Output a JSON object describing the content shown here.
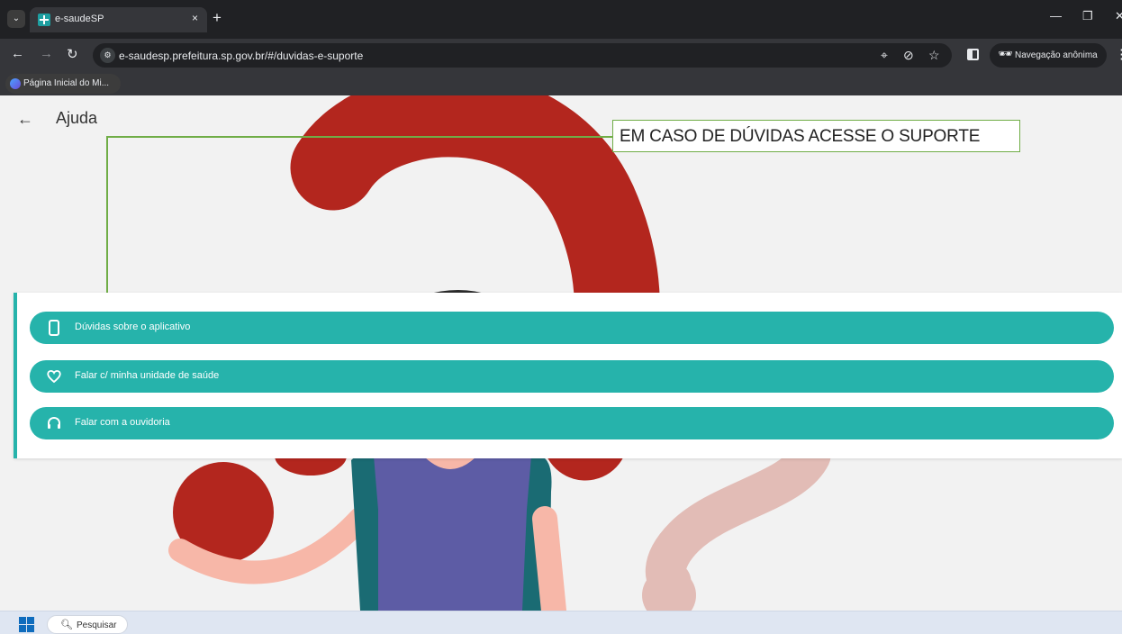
{
  "browser": {
    "tab_title": "e-saudeSP",
    "tab_close": "×",
    "new_tab": "+",
    "url": "e-saudesp.prefeitura.sp.gov.br/#/duvidas-e-suporte",
    "incognito_label": "Navegação anônima",
    "bookmark_label": "Página Inicial do Mi..."
  },
  "page": {
    "title": "Ajuda",
    "annotation": "EM CASO DE DÚVIDAS ACESSE O SUPORTE",
    "accent_color": "#26b3ab",
    "menu_items": [
      {
        "label": "Dúvidas sobre o aplicativo",
        "icon": "smartphone-icon"
      },
      {
        "label": "Falar c/ minha unidade de saúde",
        "icon": "heart-icon"
      },
      {
        "label": "Falar com a ouvidoria",
        "icon": "headset-icon"
      }
    ]
  },
  "taskbar": {
    "search_label": "Pesquisar"
  }
}
